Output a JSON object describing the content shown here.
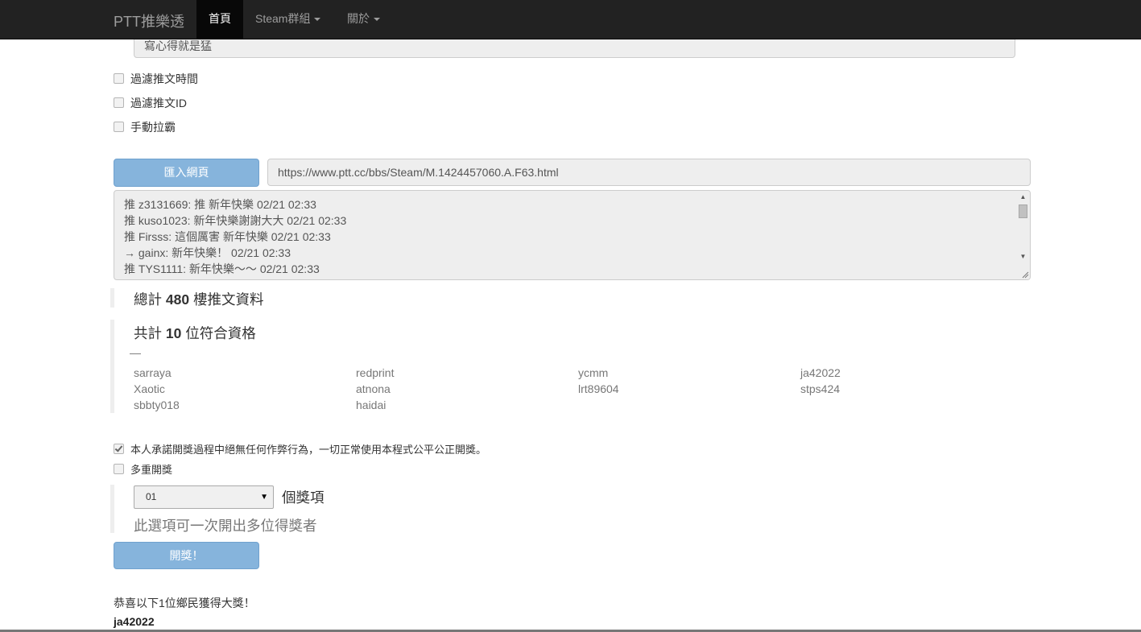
{
  "navbar": {
    "brand": "PTT推樂透",
    "items": [
      {
        "label": "首頁",
        "active": true
      },
      {
        "label": "Steam群組",
        "dropdown": true
      },
      {
        "label": "關於",
        "dropdown": true
      }
    ]
  },
  "form": {
    "top_input_value": "寫心得就是猛",
    "checkboxes": [
      {
        "label": "過濾推文時間",
        "checked": false
      },
      {
        "label": "過濾推文ID",
        "checked": false
      },
      {
        "label": "手動拉霸",
        "checked": false
      }
    ],
    "import_button": "匯入網頁",
    "url_value": "https://www.ptt.cc/bbs/Steam/M.1424457060.A.F63.html",
    "comments": [
      "推 z3131669: 推 新年快樂 02/21 02:33",
      "推 kuso1023: 新年快樂謝謝大大 02/21 02:33",
      "推 Firsss: 這個厲害 新年快樂 02/21 02:33",
      "→ gainx: 新年快樂！ 02/21 02:33",
      "推 TYS1111: 新年快樂～～ 02/21 02:33"
    ]
  },
  "stats": {
    "total_prefix": "總計",
    "total_count": "480",
    "total_suffix": "樓推文資料",
    "qualified_prefix": "共計",
    "qualified_count": "10",
    "qualified_suffix": "位符合資格",
    "divider": "—",
    "qualified_users": [
      "sarraya",
      "redprint",
      "ycmm",
      "ja42022",
      "Xaotic",
      "atnona",
      "lrt89604",
      "stps424",
      "sbbty018",
      "haidai"
    ]
  },
  "draw": {
    "promise_label": "本人承諾開獎過程中絕無任何作弊行為，一切正常使用本程式公平公正開獎。",
    "promise_checked": true,
    "multi_label": "多重開獎",
    "multi_checked": false,
    "prize_count_value": "01",
    "prize_unit": "個獎項",
    "multi_hint": "此選項可一次開出多位得獎者",
    "draw_button": "開獎！"
  },
  "result": {
    "congrats": "恭喜以下1位鄉民獲得大獎！",
    "winner": "ja42022"
  }
}
